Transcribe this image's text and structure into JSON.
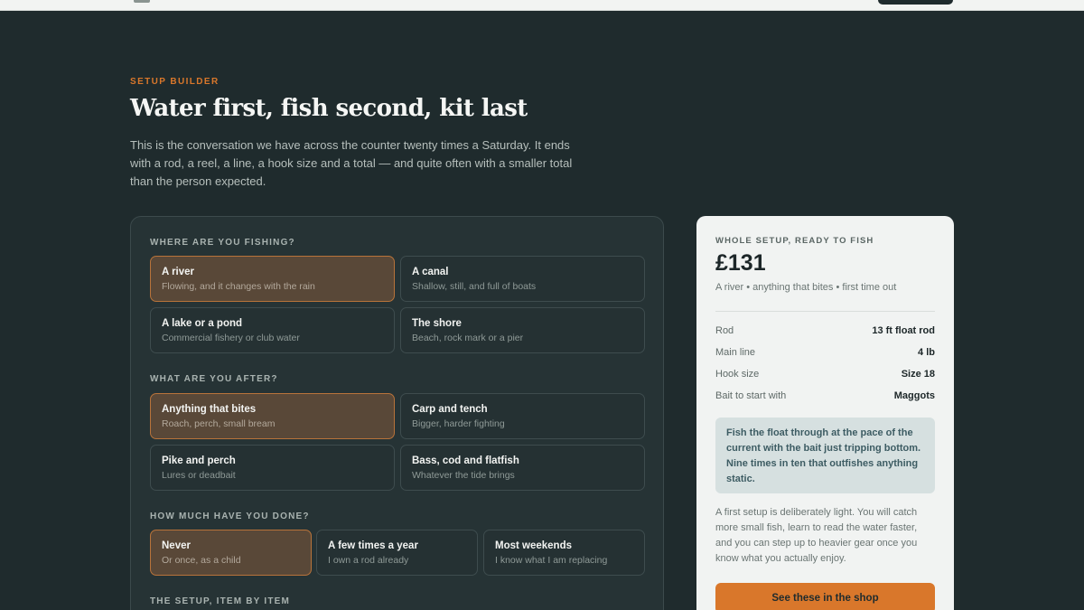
{
  "header": {
    "eyebrow": "SETUP BUILDER",
    "title": "Water first, fish second, kit last",
    "intro": "This is the conversation we have across the counter twenty times a Saturday. It ends with a rod, a reel, a line, a hook size and a total — and quite often with a smaller total than the person expected."
  },
  "builder": {
    "where": {
      "label": "WHERE ARE YOU FISHING?",
      "options": [
        {
          "title": "A river",
          "sub": "Flowing, and it changes with the rain",
          "selected": true
        },
        {
          "title": "A canal",
          "sub": "Shallow, still, and full of boats",
          "selected": false
        },
        {
          "title": "A lake or a pond",
          "sub": "Commercial fishery or club water",
          "selected": false
        },
        {
          "title": "The shore",
          "sub": "Beach, rock mark or a pier",
          "selected": false
        }
      ]
    },
    "target": {
      "label": "WHAT ARE YOU AFTER?",
      "options": [
        {
          "title": "Anything that bites",
          "sub": "Roach, perch, small bream",
          "selected": true
        },
        {
          "title": "Carp and tench",
          "sub": "Bigger, harder fighting",
          "selected": false
        },
        {
          "title": "Pike and perch",
          "sub": "Lures or deadbait",
          "selected": false
        },
        {
          "title": "Bass, cod and flatfish",
          "sub": "Whatever the tide brings",
          "selected": false
        }
      ]
    },
    "experience": {
      "label": "HOW MUCH HAVE YOU DONE?",
      "options": [
        {
          "title": "Never",
          "sub": "Or once, as a child",
          "selected": true
        },
        {
          "title": "A few times a year",
          "sub": "I own a rod already",
          "selected": false
        },
        {
          "title": "Most weekends",
          "sub": "I know what I am replacing",
          "selected": false
        }
      ]
    },
    "setup_label": "THE SETUP, ITEM BY ITEM"
  },
  "summary": {
    "eyebrow": "WHOLE SETUP, READY TO FISH",
    "total": "£131",
    "context": "A river • anything that bites • first time out",
    "rows": [
      {
        "label": "Rod",
        "value": "13 ft float rod"
      },
      {
        "label": "Main line",
        "value": "4 lb"
      },
      {
        "label": "Hook size",
        "value": "Size 18"
      },
      {
        "label": "Bait to start with",
        "value": "Maggots"
      }
    ],
    "tip": "Fish the float through at the pace of the current with the bait just tripping bottom. Nine times in ten that outfishes anything static.",
    "note": "A first setup is deliberately light. You will catch more small fish, learn to read the water faster, and you can step up to heavier gear once you know what you actually enjoy.",
    "button_label": "See these in the shop"
  },
  "colors": {
    "background": "#1f2b2d",
    "accent": "#d9772b",
    "selected_fill": "#594838"
  }
}
